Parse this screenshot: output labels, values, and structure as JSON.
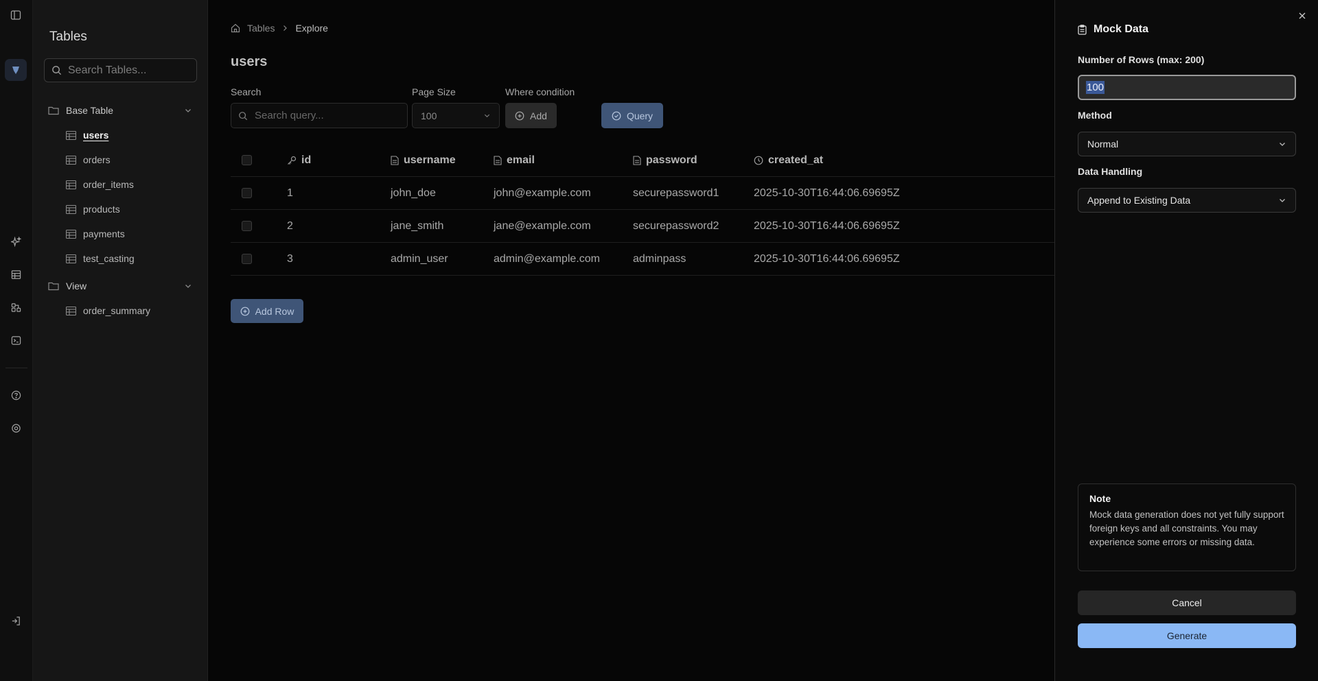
{
  "sidebar": {
    "title": "Tables",
    "search_placeholder": "Search Tables...",
    "groups": [
      {
        "label": "Base Table",
        "items": [
          "users",
          "orders",
          "order_items",
          "products",
          "payments",
          "test_casting"
        ]
      },
      {
        "label": "View",
        "items": [
          "order_summary"
        ]
      }
    ],
    "active_item": "users"
  },
  "breadcrumb": {
    "root": "Tables",
    "current": "Explore"
  },
  "page": {
    "title": "users"
  },
  "filters": {
    "search_label": "Search",
    "search_placeholder": "Search query...",
    "page_size_label": "Page Size",
    "page_size_value": "100",
    "where_label": "Where condition",
    "add_label": "Add",
    "query_label": "Query"
  },
  "table": {
    "columns": [
      "id",
      "username",
      "email",
      "password",
      "created_at"
    ],
    "rows": [
      [
        "1",
        "john_doe",
        "john@example.com",
        "securepassword1",
        "2025-10-30T16:44:06.69695Z"
      ],
      [
        "2",
        "jane_smith",
        "jane@example.com",
        "securepassword2",
        "2025-10-30T16:44:06.69695Z"
      ],
      [
        "3",
        "admin_user",
        "admin@example.com",
        "adminpass",
        "2025-10-30T16:44:06.69695Z"
      ]
    ],
    "add_row_label": "Add Row"
  },
  "panel": {
    "title": "Mock Data",
    "rows_label": "Number of Rows (max: 200)",
    "rows_value": "100",
    "method_label": "Method",
    "method_value": "Normal",
    "handling_label": "Data Handling",
    "handling_value": "Append to Existing Data",
    "note_title": "Note",
    "note_body": "Mock data generation does not yet fully support foreign keys and all constraints. You may experience some errors or missing data.",
    "cancel_label": "Cancel",
    "generate_label": "Generate"
  },
  "colors": {
    "accent": "#8ab8f5",
    "button_primary_dim": "#3f5577"
  }
}
